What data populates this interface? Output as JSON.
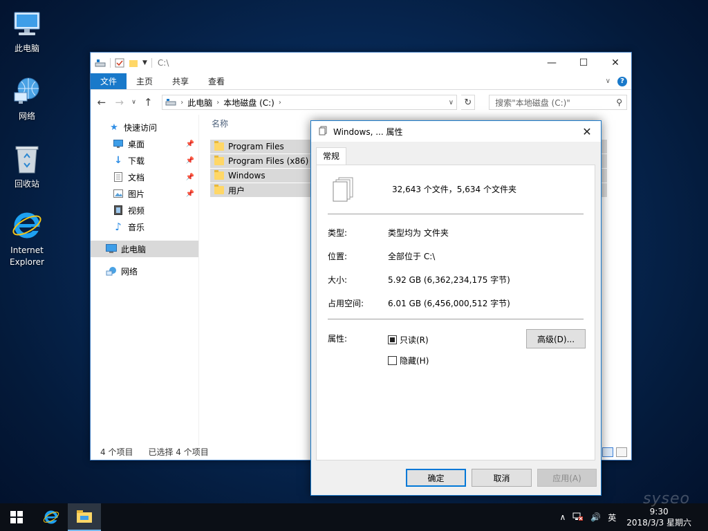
{
  "desktop": {
    "icons": [
      {
        "label": "此电脑"
      },
      {
        "label": "网络"
      },
      {
        "label": "回收站"
      },
      {
        "label": "Internet Explorer"
      }
    ]
  },
  "explorer": {
    "title": "C:\\",
    "window_buttons": {
      "minimize": "—",
      "maximize": "☐",
      "close": "✕"
    },
    "ribbon_tabs": [
      "文件",
      "主页",
      "共享",
      "查看"
    ],
    "address": {
      "segments": [
        "此电脑",
        "本地磁盘 (C:)"
      ]
    },
    "search_placeholder": "搜索\"本地磁盘 (C:)\"",
    "nav": {
      "quick_access": "快速访问",
      "items": [
        "桌面",
        "下载",
        "文档",
        "图片",
        "视频",
        "音乐"
      ],
      "this_pc": "此电脑",
      "network": "网络"
    },
    "column_header": "名称",
    "files": [
      "Program Files",
      "Program Files (x86)",
      "Windows",
      "用户"
    ],
    "status": {
      "count": "4 个项目",
      "selected": "已选择 4 个项目"
    }
  },
  "properties": {
    "title": "Windows, ... 属性",
    "tab": "常规",
    "summary": "32,643 个文件，5,634 个文件夹",
    "rows": [
      {
        "label": "类型:",
        "value": "类型均为 文件夹"
      },
      {
        "label": "位置:",
        "value": "全部位于 C:\\"
      },
      {
        "label": "大小:",
        "value": "5.92 GB (6,362,234,175 字节)"
      },
      {
        "label": "占用空间:",
        "value": "6.01 GB (6,456,000,512 字节)"
      }
    ],
    "attributes_label": "属性:",
    "readonly": "只读(R)",
    "hidden": "隐藏(H)",
    "advanced": "高级(D)...",
    "ok": "确定",
    "cancel": "取消",
    "apply": "应用(A)"
  },
  "taskbar": {
    "ime": "英",
    "time": "9:30",
    "date": "2018/3/3 星期六",
    "watermark": "syseo"
  },
  "colors": {
    "accent": "#1979ca",
    "desktop": "#072a58",
    "taskbar": "#0b0f16"
  }
}
